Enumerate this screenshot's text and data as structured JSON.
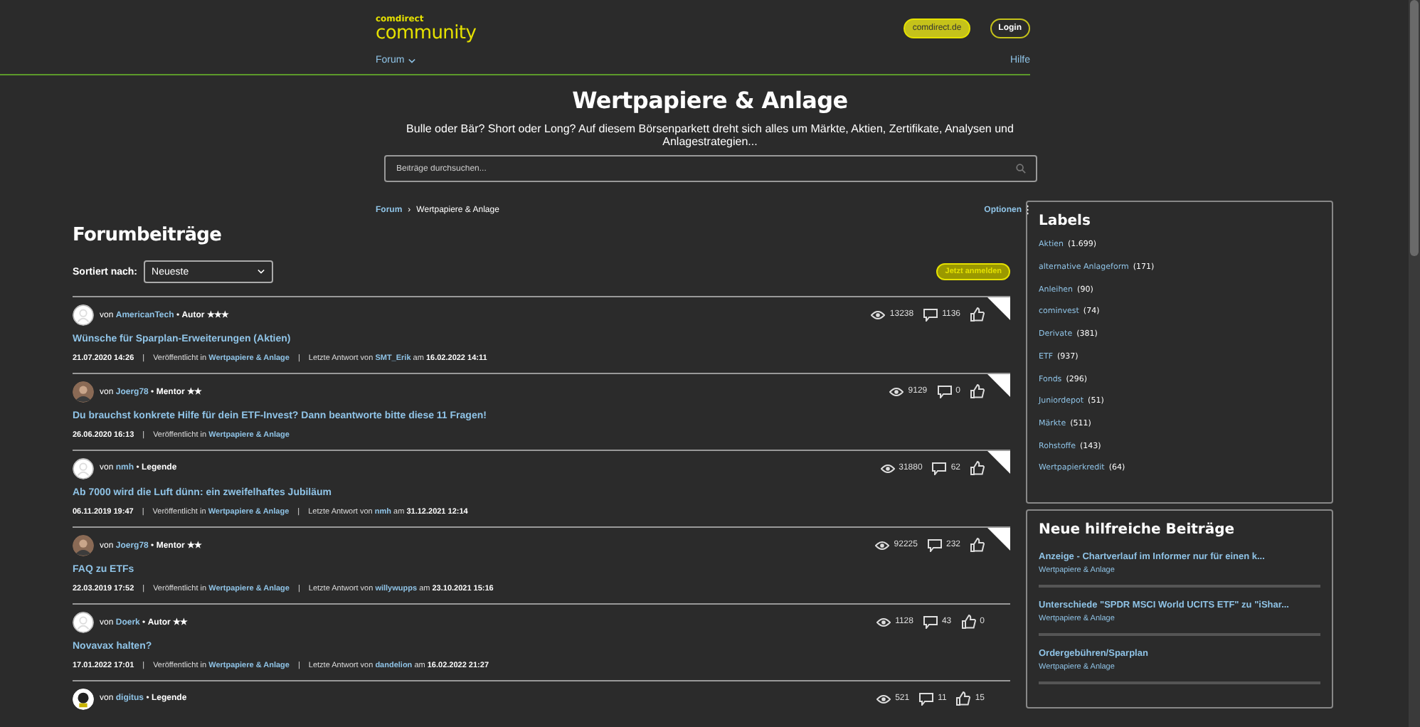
{
  "header": {
    "logo_small": "comdirect",
    "logo_big": "community",
    "site_button": "comdirect.de",
    "login_button": "Login",
    "nav": [
      {
        "label": "Forum",
        "dropdown": true
      },
      {
        "label": "Hilfe",
        "dropdown": false
      }
    ]
  },
  "hero": {
    "title": "Wertpapiere & Anlage",
    "description": "Bulle oder Bär? Short oder Long? Auf diesem Börsenparkett dreht sich alles um Märkte, Aktien, Zertifikate, Analysen und Anlagestrategien...",
    "search": {
      "placeholder": "Beiträge durchsuchen..."
    }
  },
  "breadcrumb": [
    "Forum",
    "Wertpapiere & Anlage"
  ],
  "breadcrumb_separator": "›",
  "bullet": "•",
  "meta_separator": "|",
  "options": "Optionen",
  "section_title": "Forumbeiträge",
  "sort": {
    "label": "Sortiert nach:",
    "value": "Neueste"
  },
  "subscribe_button": "Jetzt anmelden",
  "posts": [
    {
      "by": "von",
      "author": "AmericanTech",
      "rank": "Autor ★★★",
      "avatar": {
        "kind": "blank"
      },
      "views": "13238",
      "replies": "1136",
      "new": true,
      "title": "Wünsche für Sparplan-Erweiterungen (Aktien)",
      "date": "21.07.2020 14:26",
      "published_in": "Veröffentlicht in",
      "board": "Wertpapiere & Anlage",
      "last_reply": {
        "label": "Letzte Antwort von",
        "user": "SMT_Erik",
        "at": "am",
        "date": "16.02.2022 14:11"
      }
    },
    {
      "by": "von",
      "author": "Joerg78",
      "rank": "Mentor ★★",
      "avatar": {
        "kind": "photo"
      },
      "views": "9129",
      "replies": "0",
      "new": true,
      "title": "Du brauchst konkrete Hilfe für dein ETF-Invest? Dann beantworte bitte diese 11 Fragen!",
      "date": "26.06.2020 16:13",
      "published_in": "Veröffentlicht in",
      "board": "Wertpapiere & Anlage"
    },
    {
      "by": "von",
      "author": "nmh",
      "rank": "Legende",
      "avatar": {
        "kind": "blank"
      },
      "views": "31880",
      "replies": "62",
      "new": true,
      "title": "Ab 7000 wird die Luft dünn: ein zweifelhaftes Jubiläum",
      "date": "06.11.2019 19:47",
      "published_in": "Veröffentlicht in",
      "board": "Wertpapiere & Anlage",
      "last_reply": {
        "label": "Letzte Antwort von",
        "user": "nmh",
        "at": "am",
        "date": "31.12.2021 12:14"
      }
    },
    {
      "by": "von",
      "author": "Joerg78",
      "rank": "Mentor ★★",
      "avatar": {
        "kind": "photo"
      },
      "views": "92225",
      "replies": "232",
      "new": true,
      "title": "FAQ zu ETFs",
      "date": "22.03.2019 17:52",
      "published_in": "Veröffentlicht in",
      "board": "Wertpapiere & Anlage",
      "last_reply": {
        "label": "Letzte Antwort von",
        "user": "willywupps",
        "at": "am",
        "date": "23.10.2021 15:16"
      }
    },
    {
      "by": "von",
      "author": "Doerk",
      "rank": "Autor ★★",
      "avatar": {
        "kind": "blank"
      },
      "views": "1128",
      "replies": "43",
      "likes": "0",
      "new": false,
      "title": "Novavax halten?",
      "date": "17.01.2022 17:01",
      "published_in": "Veröffentlicht in",
      "board": "Wertpapiere & Anlage",
      "last_reply": {
        "label": "Letzte Antwort von",
        "user": "dandelion",
        "at": "am",
        "date": "16.02.2022 21:27"
      }
    },
    {
      "by": "von",
      "author": "digitus",
      "rank": "Legende",
      "avatar": {
        "kind": "badge"
      },
      "views": "521",
      "replies": "11",
      "likes": "15",
      "new": false
    }
  ],
  "labels": {
    "title": "Labels",
    "items": [
      {
        "name": "Aktien",
        "count": "(1.699)"
      },
      {
        "name": "alternative Anlageform",
        "count": "(171)"
      },
      {
        "name": "Anleihen",
        "count": "(90)"
      },
      {
        "name": "cominvest",
        "count": "(74)"
      },
      {
        "name": "Derivate",
        "count": "(381)"
      },
      {
        "name": "ETF",
        "count": "(937)"
      },
      {
        "name": "Fonds",
        "count": "(296)"
      },
      {
        "name": "Juniordepot",
        "count": "(51)"
      },
      {
        "name": "Märkte",
        "count": "(511)"
      },
      {
        "name": "Rohstoffe",
        "count": "(143)"
      },
      {
        "name": "Wertpapierkredit",
        "count": "(64)"
      }
    ]
  },
  "helpful": {
    "title": "Neue hilfreiche Beiträge",
    "items": [
      {
        "title": "Anzeige - Chartverlauf im Informer nur für einen k...",
        "board": "Wertpapiere & Anlage"
      },
      {
        "title": "Unterschiede \"SPDR MSCI World UCITS ETF\" zu \"iShar...",
        "board": "Wertpapiere & Anlage"
      },
      {
        "title": "Ordergebühren/Sparplan",
        "board": "Wertpapiere & Anlage"
      }
    ]
  }
}
